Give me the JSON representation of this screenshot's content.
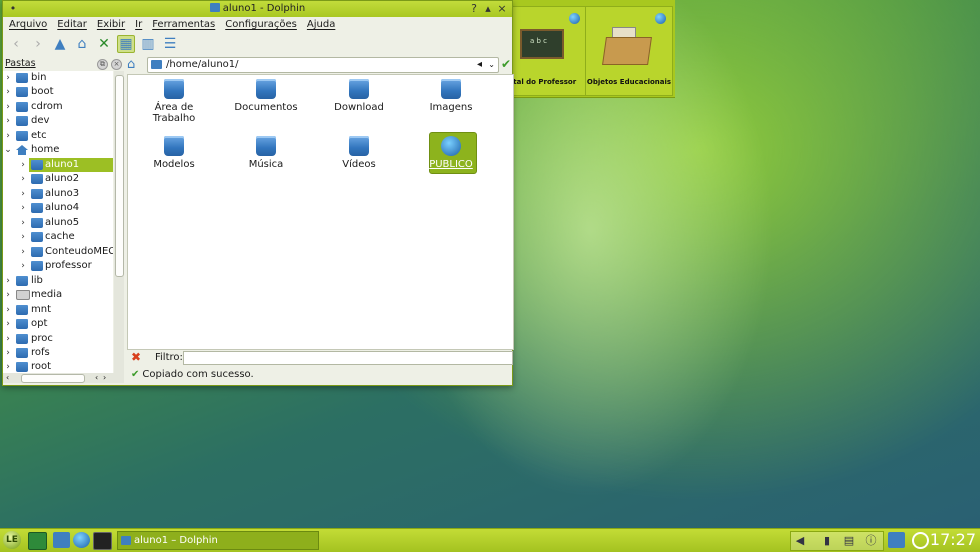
{
  "window": {
    "title": "aluno1 - Dolphin"
  },
  "menu": [
    "Arquivo",
    "Editar",
    "Exibir",
    "Ir",
    "Ferramentas",
    "Configurações",
    "Ajuda"
  ],
  "sidebar": {
    "title": "Pastas",
    "items": [
      {
        "label": "bin"
      },
      {
        "label": "boot"
      },
      {
        "label": "cdrom"
      },
      {
        "label": "dev"
      },
      {
        "label": "etc"
      },
      {
        "label": "home"
      },
      {
        "label": "aluno1"
      },
      {
        "label": "aluno2"
      },
      {
        "label": "aluno3"
      },
      {
        "label": "aluno4"
      },
      {
        "label": "aluno5"
      },
      {
        "label": "cache"
      },
      {
        "label": "ConteudoMEC"
      },
      {
        "label": "professor"
      },
      {
        "label": "lib"
      },
      {
        "label": "media"
      },
      {
        "label": "mnt"
      },
      {
        "label": "opt"
      },
      {
        "label": "proc"
      },
      {
        "label": "rofs"
      },
      {
        "label": "root"
      }
    ]
  },
  "location": {
    "path": "/home/aluno1/"
  },
  "files": [
    {
      "label": "Área de\nTrabalho"
    },
    {
      "label": "Documentos"
    },
    {
      "label": "Download"
    },
    {
      "label": "Imagens"
    },
    {
      "label": "Modelos"
    },
    {
      "label": "Música"
    },
    {
      "label": "Vídeos"
    },
    {
      "label": "PUBLICO"
    }
  ],
  "filter": {
    "label": "Filtro:"
  },
  "status": {
    "text": "Copiado com sucesso."
  },
  "desktop": {
    "tiles": [
      {
        "label": "rtal do Professor"
      },
      {
        "label": "Objetos Educacionais"
      }
    ],
    "blackboard_text": "a b c"
  },
  "taskbar": {
    "logo": "LE",
    "task_label": "aluno1 – Dolphin",
    "clock": "17:27"
  },
  "colors": {
    "accent": "#a8c81f",
    "selection": "#9cbf24",
    "folder": "#3f7fc0"
  }
}
